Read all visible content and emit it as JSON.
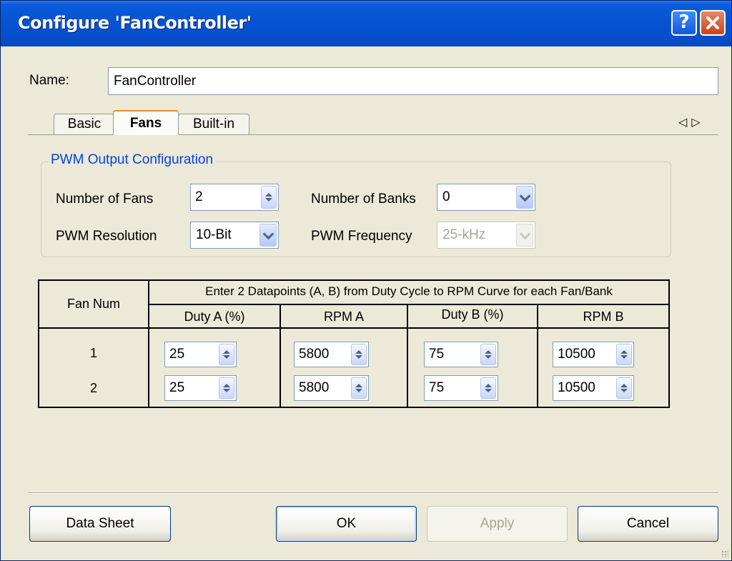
{
  "window": {
    "title": "Configure 'FanController'",
    "help_label": "?"
  },
  "name_row": {
    "label": "Name:",
    "value": "FanController"
  },
  "tabs": [
    {
      "label": "Basic",
      "active": false
    },
    {
      "label": "Fans",
      "active": true
    },
    {
      "label": "Built-in",
      "active": false
    }
  ],
  "group": {
    "title": "PWM Output Configuration",
    "num_fans_label": "Number of Fans",
    "num_fans_value": "2",
    "num_banks_label": "Number of Banks",
    "num_banks_value": "0",
    "pwm_res_label": "PWM Resolution",
    "pwm_res_value": "10-Bit",
    "pwm_freq_label": "PWM Frequency",
    "pwm_freq_value": "25-kHz"
  },
  "table": {
    "fan_num_header": "Fan Num",
    "span_header": "Enter 2 Datapoints (A, B) from Duty Cycle to RPM Curve for each Fan/Bank",
    "columns": [
      "Duty A (%)",
      "RPM A",
      "Duty B (%)",
      "RPM B"
    ],
    "rows": [
      {
        "fan": "1",
        "duty_a": "25",
        "rpm_a": "5800",
        "duty_b": "75",
        "rpm_b": "10500"
      },
      {
        "fan": "2",
        "duty_a": "25",
        "rpm_a": "5800",
        "duty_b": "75",
        "rpm_b": "10500"
      }
    ]
  },
  "buttons": {
    "datasheet": "Data Sheet",
    "ok": "OK",
    "apply": "Apply",
    "cancel": "Cancel"
  },
  "colors": {
    "titlebar": "#0653d3",
    "group_title": "#0046d5",
    "active_tab_accent": "#e68b2c",
    "background": "#ece9d8"
  }
}
